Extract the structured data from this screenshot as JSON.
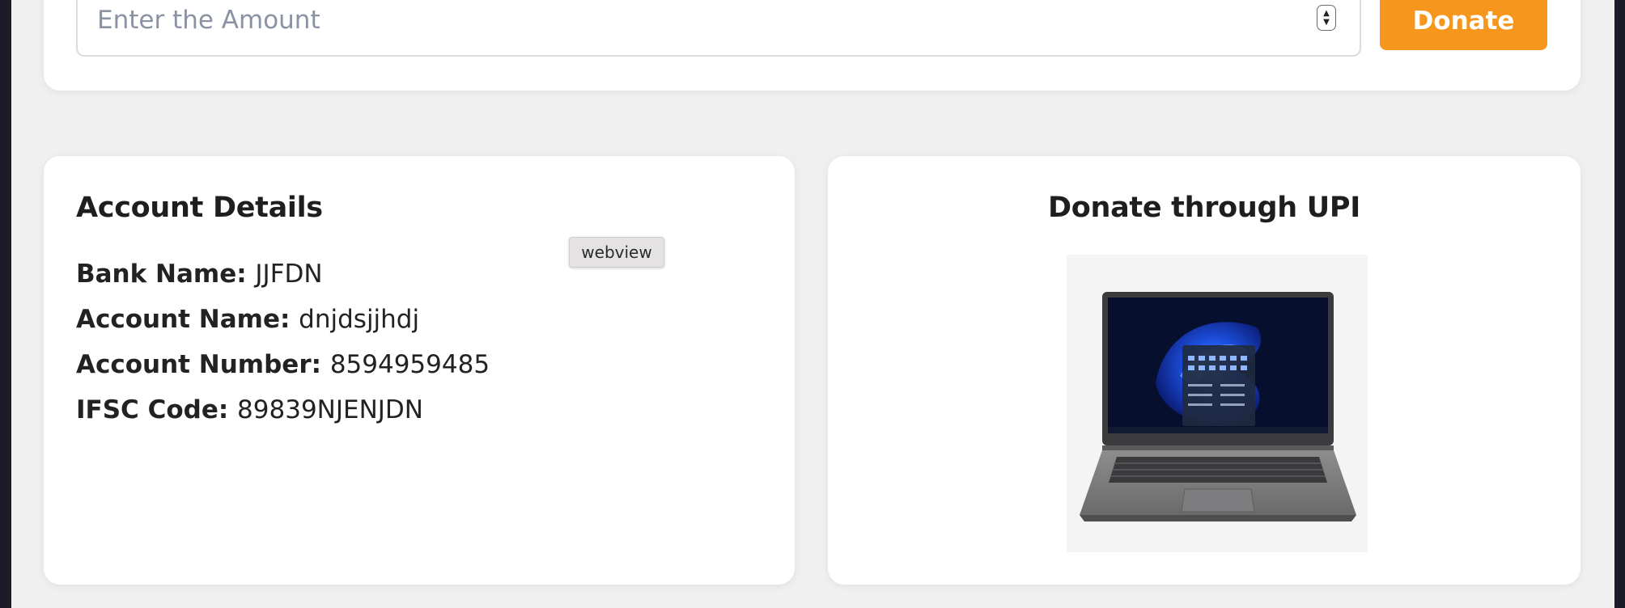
{
  "donate": {
    "amount_placeholder": "Enter the Amount",
    "button_label": "Donate"
  },
  "account": {
    "title": "Account Details",
    "rows": [
      {
        "label": "Bank Name:",
        "value": "JJFDN"
      },
      {
        "label": "Account Name:",
        "value": "dnjdsjjhdj"
      },
      {
        "label": "Account Number:",
        "value": "8594959485"
      },
      {
        "label": "IFSC Code:",
        "value": "89839NJENJDN"
      }
    ]
  },
  "tooltip": {
    "text": "webview"
  },
  "upi": {
    "title": "Donate through UPI",
    "image_icon": "laptop-product-image"
  },
  "colors": {
    "accent": "#f7961c",
    "page_background": "#f1f0f1",
    "card_background": "#ffffff",
    "frame_background": "#1b1c27"
  }
}
